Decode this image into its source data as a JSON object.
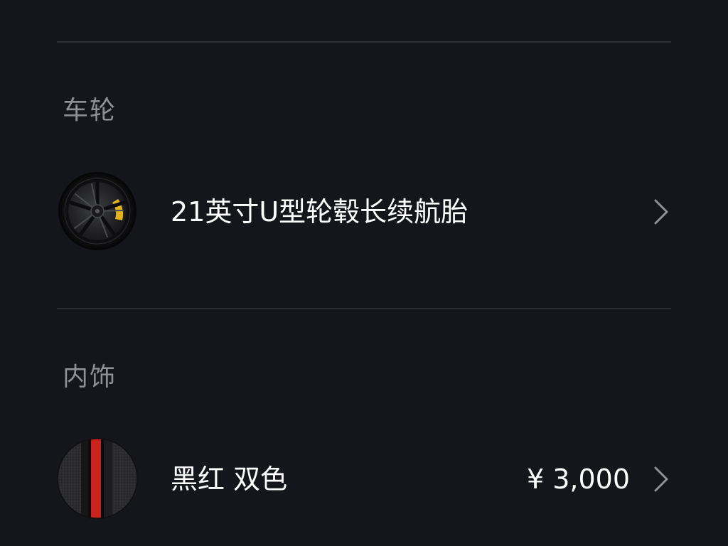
{
  "sections": {
    "wheels": {
      "title": "车轮",
      "option": {
        "label": "21英寸U型轮毂长续航胎",
        "price": "",
        "thumbnail_icon": "wheel-thumbnail-icon"
      }
    },
    "interior": {
      "title": "内饰",
      "option": {
        "label": "黑红 双色",
        "price": "¥ 3,000",
        "thumbnail_icon": "interior-swatch-icon"
      }
    }
  },
  "colors": {
    "background": "#14161b",
    "divider": "#2c2f35",
    "section_title": "#8d9096",
    "text": "#ffffff",
    "chevron": "#8f9298",
    "caliper": "#e3b21c",
    "interior_red": "#c8231c"
  }
}
